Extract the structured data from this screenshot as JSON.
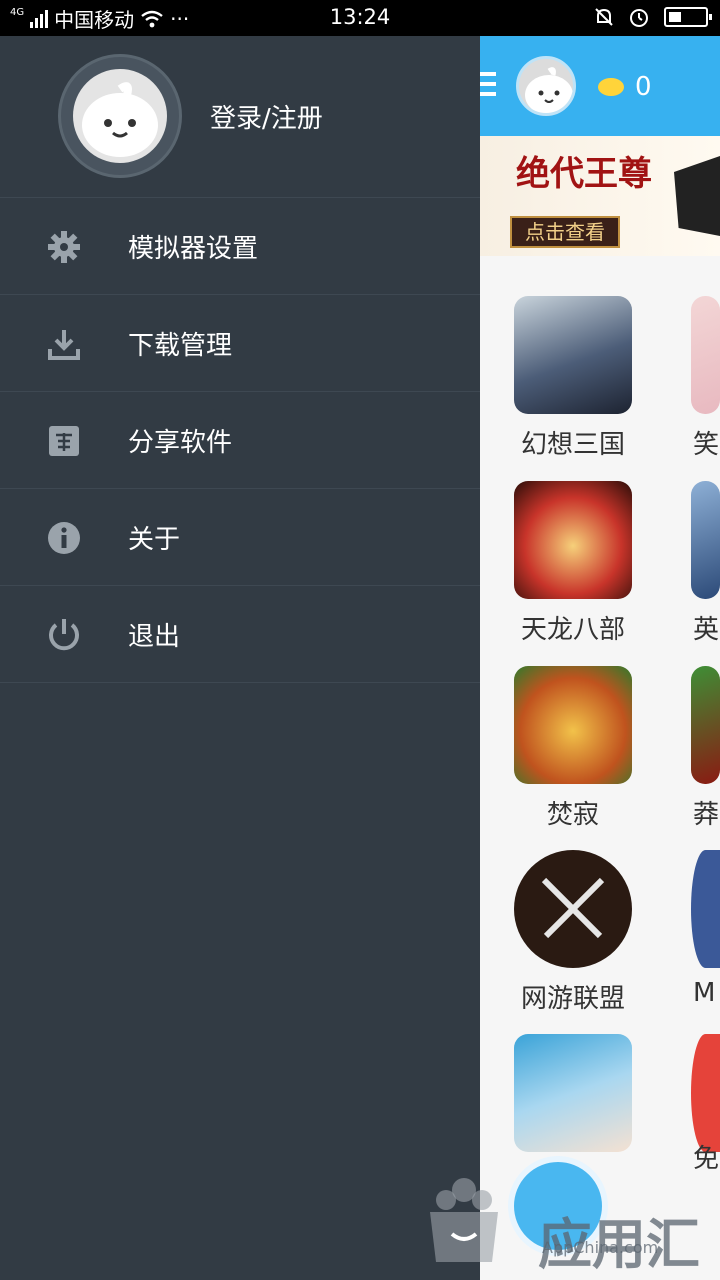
{
  "status_bar": {
    "network": "4G",
    "carrier": "中国移动",
    "more": "···",
    "time": "13:24"
  },
  "drawer": {
    "login_label": "登录/注册",
    "menu": [
      {
        "label": "模拟器设置",
        "icon": "gear-icon"
      },
      {
        "label": "下载管理",
        "icon": "download-icon"
      },
      {
        "label": "分享软件",
        "icon": "recommend-icon"
      },
      {
        "label": "关于",
        "icon": "info-icon"
      },
      {
        "label": "退出",
        "icon": "power-icon"
      }
    ]
  },
  "main": {
    "coin_count": "0",
    "banner": {
      "title": "绝代王尊",
      "button": "点击查看"
    },
    "apps": [
      {
        "name": "幻想三国"
      },
      {
        "name": "笑"
      },
      {
        "name": "天龙八部"
      },
      {
        "name": "英"
      },
      {
        "name": "焚寂"
      },
      {
        "name": "莽"
      },
      {
        "name": "网游联盟"
      },
      {
        "name": "M"
      },
      {
        "name": "免"
      }
    ]
  },
  "watermark": {
    "text": "应用汇",
    "sub": "AppChina.com"
  },
  "colors": {
    "drawer_bg": "#323b44",
    "accent_blue": "#37b1f0",
    "menu_icon": "#9aa3ab"
  }
}
